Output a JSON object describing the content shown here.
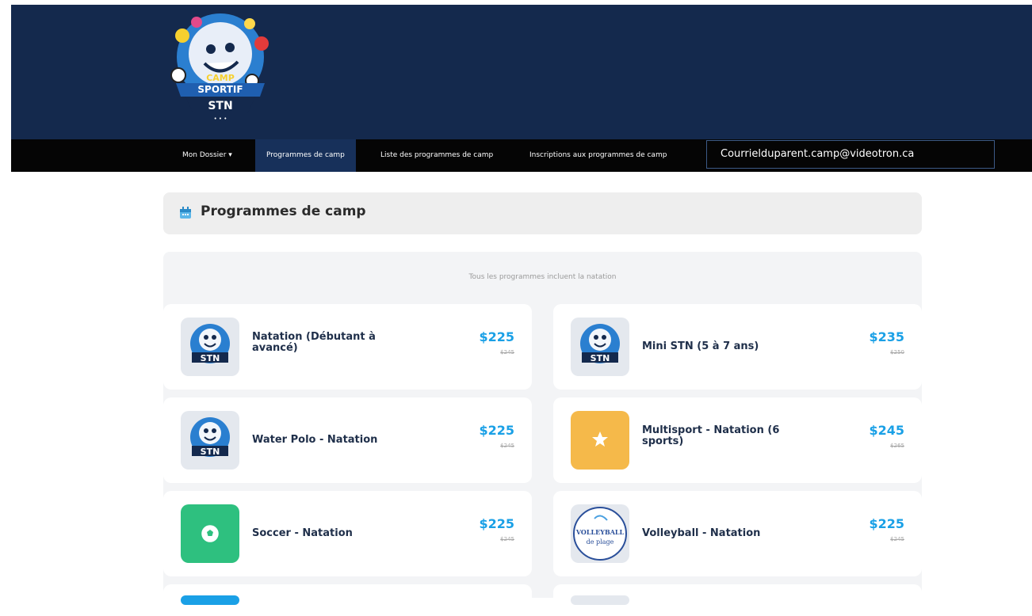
{
  "header": {
    "logo_text": [
      "CAMP",
      "SPORTIF",
      "STN"
    ],
    "brand_color": "#14294d"
  },
  "nav": {
    "items": [
      {
        "label": "Mon Dossier ▾",
        "active": false
      },
      {
        "label": "Programmes de camp",
        "active": true
      },
      {
        "label": "Liste des programmes de camp",
        "active": false
      },
      {
        "label": "Inscriptions aux programmes de camp",
        "active": false
      }
    ],
    "email": "Courrielduparent.camp@videotron.ca"
  },
  "page": {
    "title": "Programmes de camp",
    "note": "Tous les programmes incluent la natation"
  },
  "programs": [
    {
      "name": "Natation (Débutant à avancé)",
      "price": "$225",
      "old_price": "$245",
      "thumb": "stn-logo"
    },
    {
      "name": "Mini STN (5 à 7 ans)",
      "price": "$235",
      "old_price": "$250",
      "thumb": "stn-logo"
    },
    {
      "name": "Water Polo - Natation",
      "price": "$225",
      "old_price": "$245",
      "thumb": "stn-logo"
    },
    {
      "name": "Multisport - Natation (6 sports)",
      "price": "$245",
      "old_price": "$265",
      "thumb": "star-icon"
    },
    {
      "name": "Soccer - Natation",
      "price": "$225",
      "old_price": "$245",
      "thumb": "soccer-icon"
    },
    {
      "name": "Volleyball - Natation",
      "price": "$225",
      "old_price": "$245",
      "thumb": "volleyball-logo"
    }
  ],
  "volleyball_logo_text": [
    "VOLLEYBALL",
    "de plage"
  ],
  "stn_logo_text": "STN",
  "colors": {
    "accent": "#1aa0e6",
    "star_bg": "#f5b94a",
    "soccer_bg": "#2ec07f"
  }
}
